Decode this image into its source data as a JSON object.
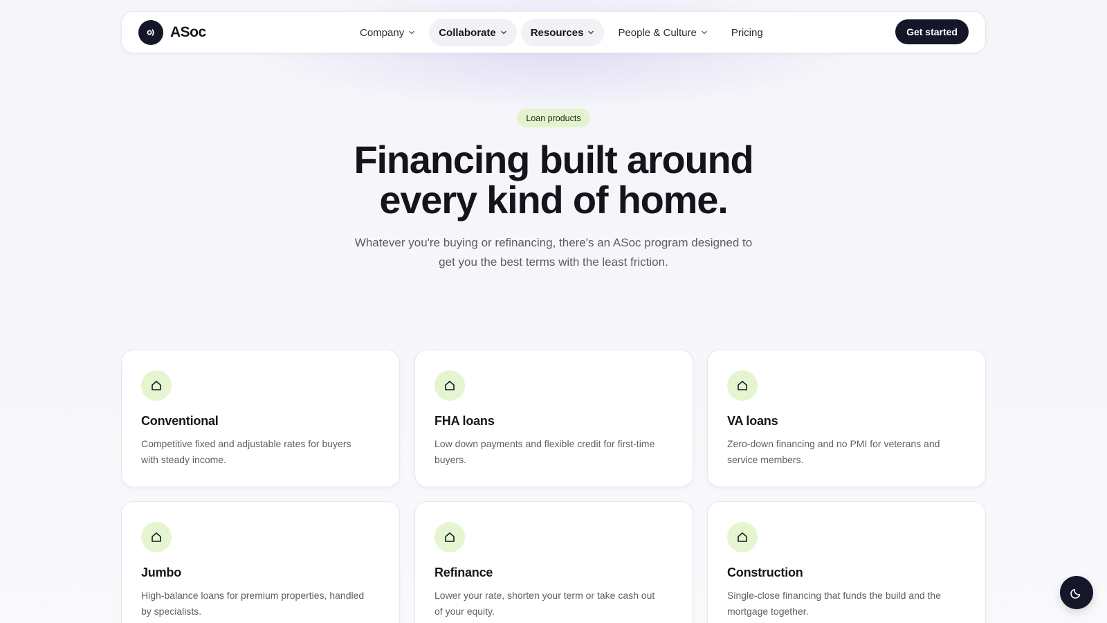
{
  "nav": {
    "brand": "ASoc",
    "items": [
      {
        "label": "Company",
        "dropdown": true,
        "active": false
      },
      {
        "label": "Collaborate",
        "dropdown": true,
        "active": true
      },
      {
        "label": "Resources",
        "dropdown": true,
        "active": true
      },
      {
        "label": "People & Culture",
        "dropdown": true,
        "active": false
      },
      {
        "label": "Pricing",
        "dropdown": false,
        "active": false
      }
    ],
    "cta": "Get started"
  },
  "hero": {
    "eyebrow": "Loan products",
    "title_line1": "Financing built around",
    "title_line2": "every kind of home.",
    "subtitle_line1": "Whatever you're buying or refinancing, there's an ASoc program designed to",
    "subtitle_line2": "get you the best terms with the least friction."
  },
  "cards": [
    {
      "title": "Conventional",
      "desc": "Competitive fixed and adjustable rates for buyers with steady income.",
      "icon": "house-icon"
    },
    {
      "title": "FHA loans",
      "desc": "Low down payments and flexible credit for first-time buyers.",
      "icon": "house-icon"
    },
    {
      "title": "VA loans",
      "desc": "Zero-down financing and no PMI for veterans and service members.",
      "icon": "house-icon"
    },
    {
      "title": "Jumbo",
      "desc": "High-balance loans for premium properties, handled by specialists.",
      "icon": "house-icon"
    },
    {
      "title": "Refinance",
      "desc": "Lower your rate, shorten your term or take cash out of your equity.",
      "icon": "house-icon"
    },
    {
      "title": "Construction",
      "desc": "Single-close financing that funds the build and the mortgage together.",
      "icon": "house-icon"
    }
  ],
  "theme_toggle": {
    "icon": "moon-icon"
  },
  "colors": {
    "primary_dark": "#16162a",
    "accent_green": "#e5f5cf",
    "muted_text": "#5b5b68"
  }
}
